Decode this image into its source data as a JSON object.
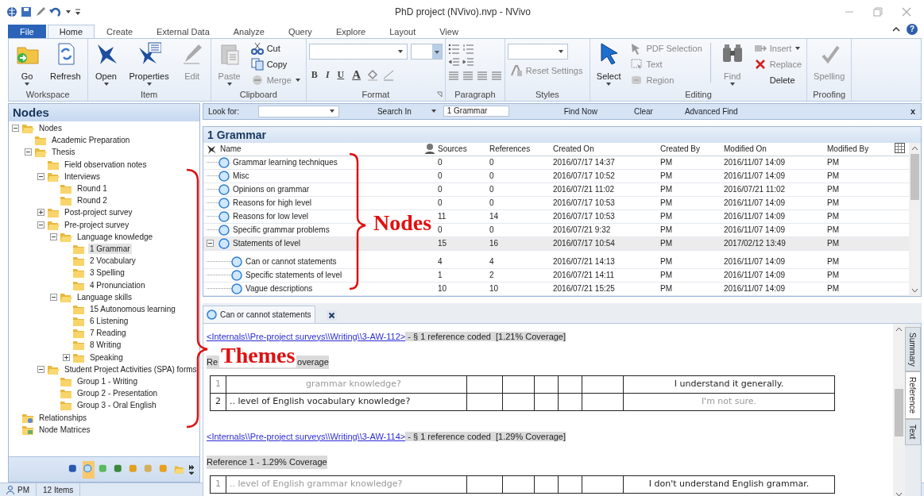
{
  "window": {
    "title": "PhD project (NVivo).nvp - NVivo",
    "help_glyph": "?"
  },
  "ribbon": {
    "tabs": [
      {
        "label": "File",
        "kind": "file",
        "selected": false
      },
      {
        "label": "Home",
        "kind": "tab",
        "selected": true
      },
      {
        "label": "Create",
        "kind": "tab",
        "selected": false
      },
      {
        "label": "External Data",
        "kind": "tab",
        "selected": false
      },
      {
        "label": "Analyze",
        "kind": "tab",
        "selected": false
      },
      {
        "label": "Query",
        "kind": "tab",
        "selected": false
      },
      {
        "label": "Explore",
        "kind": "tab",
        "selected": false
      },
      {
        "label": "Layout",
        "kind": "tab",
        "selected": false
      },
      {
        "label": "View",
        "kind": "tab",
        "selected": false
      }
    ],
    "groups": [
      {
        "label": "Workspace",
        "launcher": false,
        "items": [
          {
            "kind": "large",
            "label": "Go",
            "dropdown": true,
            "disabled": false
          },
          {
            "kind": "large",
            "label": "Refresh",
            "dropdown": false,
            "disabled": false
          }
        ]
      },
      {
        "label": "Item",
        "launcher": false,
        "items": [
          {
            "kind": "large",
            "label": "Open",
            "dropdown": true,
            "disabled": false
          },
          {
            "kind": "large",
            "label": "Properties",
            "dropdown": true,
            "disabled": false
          },
          {
            "kind": "large",
            "label": "Edit",
            "dropdown": false,
            "disabled": true
          }
        ]
      },
      {
        "label": "Clipboard",
        "launcher": false,
        "items": [
          {
            "kind": "large",
            "label": "Paste",
            "dropdown": true,
            "disabled": true
          },
          {
            "kind": "stack",
            "items": [
              {
                "label": "Cut",
                "dropdown": false,
                "disabled": false
              },
              {
                "label": "Copy",
                "dropdown": false,
                "disabled": false
              },
              {
                "label": "Merge",
                "dropdown": true,
                "disabled": true
              }
            ]
          }
        ]
      },
      {
        "label": "Format",
        "launcher": true,
        "items": [
          {
            "kind": "format",
            "buttons": [
              "B",
              "I",
              "U",
              "A"
            ]
          }
        ]
      },
      {
        "label": "Paragraph",
        "launcher": false,
        "items": [
          {
            "kind": "paragraph"
          }
        ]
      },
      {
        "label": "Styles",
        "launcher": false,
        "items": [
          {
            "kind": "styles",
            "label": "Reset Settings",
            "disabled": true
          }
        ]
      },
      {
        "label": "Editing",
        "launcher": false,
        "items": [
          {
            "kind": "large",
            "label": "Select",
            "dropdown": true,
            "disabled": false
          },
          {
            "kind": "stack",
            "items": [
              {
                "label": "PDF Selection",
                "dropdown": false,
                "disabled": true
              },
              {
                "label": "Text",
                "dropdown": false,
                "disabled": true
              },
              {
                "label": "Region",
                "dropdown": false,
                "disabled": true
              }
            ]
          },
          {
            "kind": "separator"
          },
          {
            "kind": "large",
            "label": "Find",
            "dropdown": true,
            "disabled": true
          },
          {
            "kind": "stack",
            "items": [
              {
                "label": "Insert",
                "dropdown": true,
                "disabled": true
              },
              {
                "label": "Replace",
                "dropdown": false,
                "disabled": true
              },
              {
                "label": "Delete",
                "dropdown": false,
                "disabled": false
              }
            ]
          }
        ]
      },
      {
        "label": "Proofing",
        "launcher": false,
        "items": [
          {
            "kind": "large",
            "label": "Spelling",
            "dropdown": false,
            "disabled": true
          }
        ]
      }
    ]
  },
  "navigation": {
    "title": "Nodes",
    "tree": [
      {
        "label": "Nodes",
        "kind": "folder",
        "selected": false,
        "expanded": true,
        "children": [
          {
            "label": "Academic Preparation",
            "kind": "folder",
            "selected": false
          },
          {
            "label": "Thesis",
            "kind": "folder",
            "selected": false,
            "expanded": true,
            "children": [
              {
                "label": "Field observation notes",
                "kind": "folder",
                "selected": false
              },
              {
                "label": "Interviews",
                "kind": "folder",
                "selected": false,
                "expanded": true,
                "children": [
                  {
                    "label": "Round 1",
                    "kind": "folder",
                    "selected": false
                  },
                  {
                    "label": "Round 2",
                    "kind": "folder",
                    "selected": false
                  }
                ]
              },
              {
                "label": "Post-project survey",
                "kind": "folder",
                "selected": false,
                "expanded": false
              },
              {
                "label": "Pre-project survey",
                "kind": "folder",
                "selected": false,
                "expanded": true,
                "children": [
                  {
                    "label": "Language knowledge",
                    "kind": "folder",
                    "selected": false,
                    "expanded": true,
                    "children": [
                      {
                        "label": "1 Grammar",
                        "kind": "folder",
                        "selected": true
                      },
                      {
                        "label": "2 Vocabulary",
                        "kind": "folder",
                        "selected": false
                      },
                      {
                        "label": "3 Spelling",
                        "kind": "folder",
                        "selected": false
                      },
                      {
                        "label": "4 Pronunciation",
                        "kind": "folder",
                        "selected": false
                      }
                    ]
                  },
                  {
                    "label": "Language skills",
                    "kind": "folder",
                    "selected": false,
                    "expanded": true,
                    "children": [
                      {
                        "label": "15 Autonomous learning",
                        "kind": "folder",
                        "selected": false
                      },
                      {
                        "label": "6 Listening",
                        "kind": "folder",
                        "selected": false
                      },
                      {
                        "label": "7 Reading",
                        "kind": "folder",
                        "selected": false
                      },
                      {
                        "label": "8 Writing",
                        "kind": "folder",
                        "selected": false
                      },
                      {
                        "label": "Speaking",
                        "kind": "folder",
                        "selected": false,
                        "expanded": false
                      }
                    ]
                  }
                ]
              },
              {
                "label": "Student Project Activities (SPA) forms",
                "kind": "folder",
                "selected": false,
                "expanded": true,
                "children": [
                  {
                    "label": "Group 1 - Writing",
                    "kind": "folder",
                    "selected": false
                  },
                  {
                    "label": "Group 2 - Presentation",
                    "kind": "folder",
                    "selected": false
                  },
                  {
                    "label": "Group 3 - Oral English",
                    "kind": "folder",
                    "selected": false
                  }
                ]
              }
            ]
          }
        ]
      },
      {
        "label": "Relationships",
        "kind": "relationships",
        "selected": false
      },
      {
        "label": "Node Matrices",
        "kind": "matrices",
        "selected": false
      }
    ],
    "nav_buttons": [
      {
        "kind": "sources",
        "selected": false
      },
      {
        "kind": "nodes",
        "selected": true
      },
      {
        "kind": "classifications",
        "selected": false
      },
      {
        "kind": "collections",
        "selected": false
      },
      {
        "kind": "queries",
        "selected": false
      },
      {
        "kind": "reports",
        "selected": false
      },
      {
        "kind": "maps",
        "selected": false
      },
      {
        "kind": "folders",
        "selected": false
      }
    ]
  },
  "find_bar": {
    "look_for_label": "Look for:",
    "search_in_label": "Search In",
    "search_in_value": "1 Grammar",
    "buttons": [
      "Find Now",
      "Clear",
      "Advanced Find"
    ],
    "close_glyph": "x"
  },
  "list_view": {
    "title": "1 Grammar",
    "columns": [
      "Name",
      "Sources",
      "References",
      "Created On",
      "Created By",
      "Modified On",
      "Modified By"
    ],
    "rows": [
      {
        "name": "Grammar learning techniques",
        "sources": "0",
        "references": "0",
        "created_on": "2016/07/17 14:37",
        "created_by": "PM",
        "modified_on": "2016/11/07 14:09",
        "modified_by": "PM",
        "selected": false
      },
      {
        "name": "Misc",
        "sources": "0",
        "references": "0",
        "created_on": "2016/07/17 10:52",
        "created_by": "PM",
        "modified_on": "2016/11/07 14:09",
        "modified_by": "PM",
        "selected": false
      },
      {
        "name": "Opinions on grammar",
        "sources": "0",
        "references": "0",
        "created_on": "2016/07/21 11:02",
        "created_by": "PM",
        "modified_on": "2016/07/21 11:02",
        "modified_by": "PM",
        "selected": false
      },
      {
        "name": "Reasons for high level",
        "sources": "0",
        "references": "0",
        "created_on": "2016/07/17 10:53",
        "created_by": "PM",
        "modified_on": "2016/11/07 14:09",
        "modified_by": "PM",
        "selected": false
      },
      {
        "name": "Reasons for low level",
        "sources": "11",
        "references": "14",
        "created_on": "2016/07/17 10:53",
        "created_by": "PM",
        "modified_on": "2016/11/07 14:09",
        "modified_by": "PM",
        "selected": false
      },
      {
        "name": "Specific grammar problems",
        "sources": "0",
        "references": "0",
        "created_on": "2016/07/21 9:32",
        "created_by": "PM",
        "modified_on": "2016/11/07 14:09",
        "modified_by": "PM",
        "selected": false
      },
      {
        "name": "Statements of level",
        "sources": "15",
        "references": "16",
        "created_on": "2016/07/17 10:54",
        "created_by": "PM",
        "modified_on": "2017/02/12 13:49",
        "modified_by": "PM",
        "selected": true,
        "expanded": true,
        "children": [
          {
            "name": "Can or cannot statements",
            "sources": "4",
            "references": "4",
            "created_on": "2016/07/21 14:13",
            "created_by": "PM",
            "modified_on": "2016/11/07 14:09",
            "modified_by": "PM",
            "selected": false
          },
          {
            "name": "Specific statements of level",
            "sources": "1",
            "references": "2",
            "created_on": "2016/07/21 14:11",
            "created_by": "PM",
            "modified_on": "2016/11/07 14:09",
            "modified_by": "PM",
            "selected": false
          },
          {
            "name": "Vague descriptions",
            "sources": "10",
            "references": "10",
            "created_on": "2016/07/21 15:25",
            "created_by": "PM",
            "modified_on": "2016/11/07 14:09",
            "modified_by": "PM",
            "selected": false
          }
        ]
      }
    ]
  },
  "detail": {
    "tab": {
      "label": "Can or cannot statements"
    },
    "side_tabs": [
      {
        "label": "Summary",
        "selected": false
      },
      {
        "label": "Reference",
        "selected": true
      },
      {
        "label": "Text",
        "selected": false
      }
    ],
    "references": [
      {
        "link": "<Internals\\\\Pre-project surveys\\\\Writing\\\\3-AW-112>",
        "summary": " - § 1 reference coded  [1.21% Coverage]",
        "heading": [
          "Re",
          "overage"
        ],
        "rows": [
          {
            "number": "1",
            "question": "grammar knowledge?",
            "answer": "I understand it generally.",
            "number_muted": true,
            "question_muted": true,
            "answer_muted": false
          },
          {
            "number": "2",
            "question": ".. level of English vocabulary knowledge?",
            "answer": "I'm not sure.",
            "number_muted": false,
            "question_muted": false,
            "answer_muted": true
          }
        ]
      },
      {
        "link": "<Internals\\\\Pre-project surveys\\\\Writing\\\\3-AW-114>",
        "summary": " - § 1 reference coded  [1.29% Coverage]",
        "heading": [
          "Reference 1 - 1.29% Coverage"
        ],
        "rows": [
          {
            "number": "1",
            "question": ".. level of English grammar knowledge?",
            "answer": "I don't understand English grammar.",
            "number_muted": true,
            "question_muted": true,
            "answer_muted": false
          }
        ]
      }
    ]
  },
  "status_bar": {
    "user": "PM",
    "items": "12 Items"
  },
  "annotations": [
    {
      "text": "Nodes"
    },
    {
      "text": "Themes"
    }
  ]
}
